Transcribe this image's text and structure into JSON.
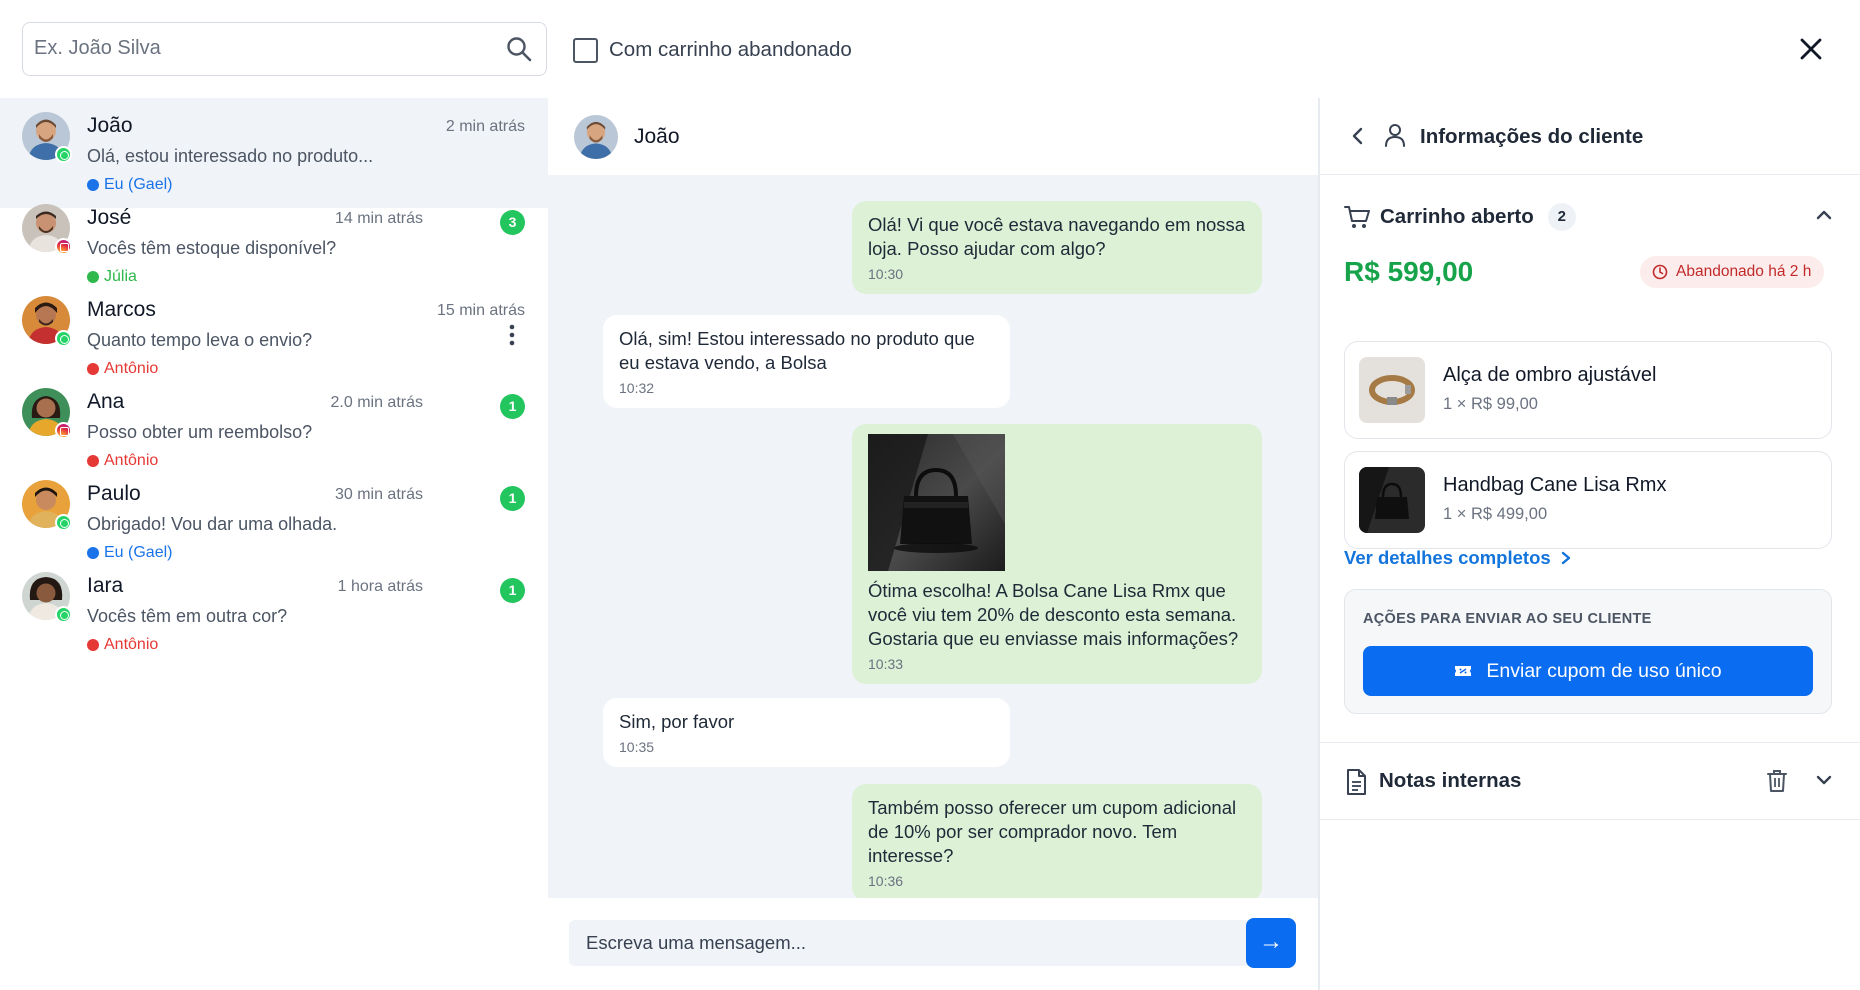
{
  "search": {
    "placeholder": "Ex. João Silva",
    "icon": "search-icon"
  },
  "filter": {
    "label": "Com carrinho abandonado",
    "checked": false
  },
  "close": {
    "icon": "close-icon"
  },
  "conversations": [
    {
      "name": "João",
      "time": "2 min atrás",
      "preview": "Olá, estou interessado no produto...",
      "agent": "Eu (Gael)",
      "agent_color": "#1a73e8",
      "channel": "whatsapp",
      "unread": ""
    },
    {
      "name": "José",
      "time": "14 min atrás",
      "preview": "Vocês têm estoque disponível?",
      "agent": "Júlia",
      "agent_color": "#2fb84b",
      "channel": "instagram",
      "unread": "3"
    },
    {
      "name": "Marcos",
      "time": "15 min atrás",
      "preview": "Quanto tempo leva o envio?",
      "agent": "Antônio",
      "agent_color": "#e53935",
      "channel": "whatsapp",
      "unread": ""
    },
    {
      "name": "Ana",
      "time": "2.0 min atrás",
      "preview": "Posso obter um reembolso?",
      "agent": "Antônio",
      "agent_color": "#e53935",
      "channel": "instagram",
      "unread": "1"
    },
    {
      "name": "Paulo",
      "time": "30 min atrás",
      "preview": "Obrigado! Vou dar uma olhada.",
      "agent": "Eu (Gael)",
      "agent_color": "#1a73e8",
      "channel": "whatsapp",
      "unread": "1"
    },
    {
      "name": "Iara",
      "time": "1 hora atrás",
      "preview": "Vocês têm em outra cor?",
      "agent": "Antônio",
      "agent_color": "#e53935",
      "channel": "whatsapp",
      "unread": "1"
    }
  ],
  "chat": {
    "contact_name": "João",
    "messages": [
      {
        "direction": "out",
        "text": "Olá! Vi que você estava navegando em nossa loja. Posso ajudar com algo?",
        "time": "10:30"
      },
      {
        "direction": "in",
        "text": "Olá, sim! Estou interessado no produto que eu estava vendo, a Bolsa",
        "time": "10:32"
      },
      {
        "direction": "out",
        "text": "Ótima escolha! A Bolsa Cane Lisa Rmx que você viu tem 20% de desconto esta semana. Gostaria que eu enviasse mais informações?",
        "time": "10:33",
        "image": "handbag-photo"
      },
      {
        "direction": "in",
        "text": "Sim, por favor",
        "time": "10:35"
      },
      {
        "direction": "out",
        "text": "Também posso oferecer um cupom adicional de 10% por ser comprador novo. Tem interesse?",
        "time": "10:36"
      }
    ],
    "composer_placeholder": "Escreva uma mensagem...",
    "send_label": "→"
  },
  "panel": {
    "title": "Informações do cliente",
    "cart": {
      "title": "Carrinho aberto",
      "count": "2",
      "total": "R$ 599,00",
      "abandoned_label": "Abandonado há 2 h",
      "items": [
        {
          "name": "Alça de ombro ajustável",
          "price": "1 × R$ 99,00"
        },
        {
          "name": "Handbag Cane Lisa Rmx",
          "price": "1 × R$ 499,00"
        }
      ],
      "details_link": "Ver detalhes completos",
      "actions_title": "AÇÕES PARA ENVIAR AO SEU CLIENTE",
      "coupon_button": "Enviar cupom de uso único"
    },
    "notes": {
      "title": "Notas internas"
    }
  },
  "colors": {
    "accent": "#0a6cf0",
    "online_green": "#22c55e",
    "total_green": "#16a34a",
    "abandoned_red": "#c22a2a",
    "bubble_out": "#dcf1d6"
  }
}
